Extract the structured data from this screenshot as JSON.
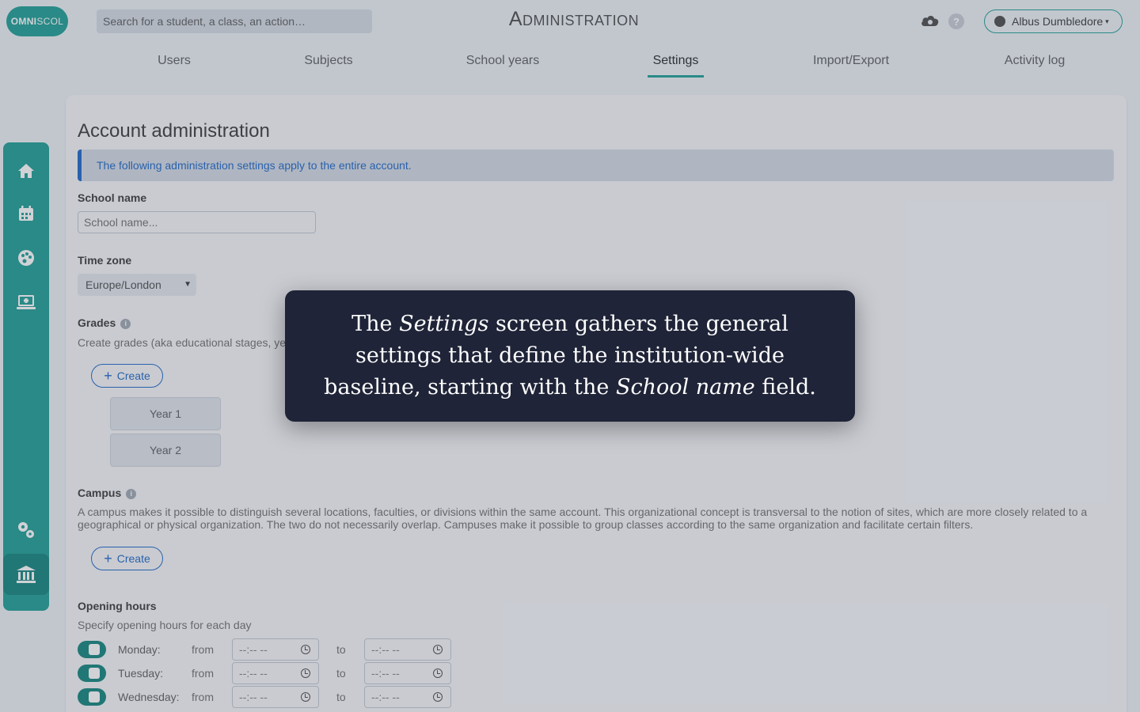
{
  "header": {
    "logo_main": "OMNI",
    "logo_light": "SCOL",
    "search_placeholder": "Search for a student, a class, an action…",
    "title": "Administration",
    "help": "?",
    "user_name": "Albus Dumbledore",
    "user_caret": "▾"
  },
  "tabs": [
    {
      "label": "Users"
    },
    {
      "label": "Subjects"
    },
    {
      "label": "School years"
    },
    {
      "label": "Settings"
    },
    {
      "label": "Import/Export"
    },
    {
      "label": "Activity log"
    }
  ],
  "page": {
    "heading": "Account administration",
    "info": "The following administration settings apply to the entire account.",
    "school_name_label": "School name",
    "school_name_placeholder": "School name...",
    "timezone_label": "Time zone",
    "timezone_value": "Europe/London",
    "grades_label": "Grades",
    "grades_desc": "Create grades (aka educational stages, ye",
    "create_label": "Create",
    "grades": [
      "Year 1",
      "Year 2"
    ],
    "campus_label": "Campus",
    "campus_desc": "A campus makes it possible to distinguish several locations, faculties, or divisions within the same account. This organizational concept is transversal to the notion of sites, which are more closely related to a geographical or physical organization. The two do not necessarily overlap. Campuses make it possible to group classes according to the same organization and facilitate certain filters.",
    "hours_label": "Opening hours",
    "hours_desc": "Specify opening hours for each day",
    "from": "from",
    "to": "to",
    "time_placeholder": "--:-- --",
    "days": [
      "Monday:",
      "Tuesday:",
      "Wednesday:"
    ]
  },
  "tooltip": {
    "part1": "The ",
    "em1": "Settings",
    "part2": " screen gathers the general settings that define the institution-wide baseline, starting with the ",
    "em2": "School name",
    "part3": " field."
  },
  "colors": {
    "accent": "#2aa39a",
    "link": "#2a6fc9",
    "tooltip_bg": "#1f2438"
  }
}
